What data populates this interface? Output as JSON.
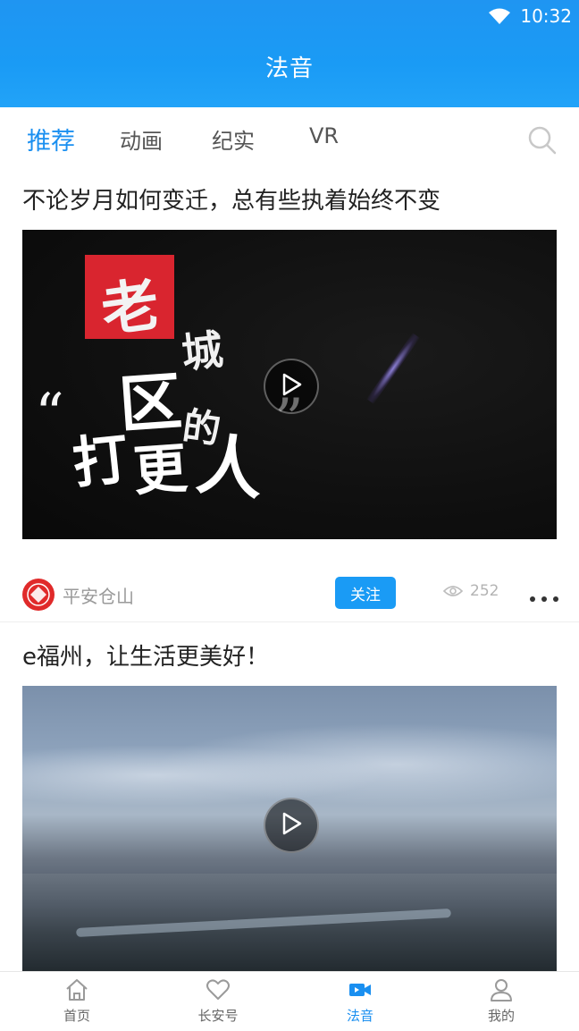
{
  "status_bar": {
    "time": "10:32",
    "wifi_icon": "wifi-icon"
  },
  "header": {
    "title": "法音"
  },
  "tabs": {
    "items": [
      {
        "label": "推荐",
        "active": true
      },
      {
        "label": "动画",
        "active": false
      },
      {
        "label": "纪实",
        "active": false
      },
      {
        "label": "VR",
        "active": false
      }
    ],
    "search_icon": "search-icon"
  },
  "feed": [
    {
      "title": "不论岁月如何变迁，总有些执着始终不变",
      "thumbnail_text": [
        "老",
        "城",
        "区",
        "的",
        "“",
        "打",
        "更",
        "人",
        "”"
      ],
      "author": "平安仓山",
      "follow_label": "关注",
      "views": "252"
    },
    {
      "title": "e福州，让生活更美好！"
    }
  ],
  "bottom_nav": {
    "items": [
      {
        "label": "首页",
        "icon": "home-icon",
        "active": false
      },
      {
        "label": "长安号",
        "icon": "heart-icon",
        "active": false
      },
      {
        "label": "法音",
        "icon": "video-camera-icon",
        "active": true
      },
      {
        "label": "我的",
        "icon": "user-icon",
        "active": false
      }
    ]
  },
  "colors": {
    "accent": "#1a9bf5",
    "active_tab": "#1a8ff0",
    "avatar_red": "#e02a2a"
  }
}
